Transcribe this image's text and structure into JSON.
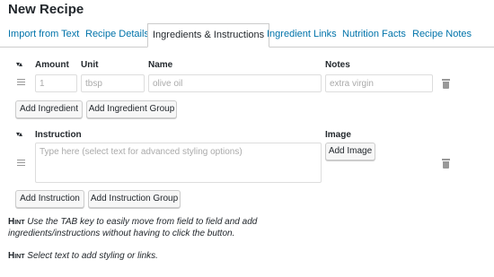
{
  "page": {
    "title": "New Recipe"
  },
  "tabs": [
    {
      "label": "Import from Text"
    },
    {
      "label": "Recipe Details"
    },
    {
      "label": "Ingredients & Instructions"
    },
    {
      "label": "Ingredient Links"
    },
    {
      "label": "Nutrition Facts"
    },
    {
      "label": "Recipe Notes"
    }
  ],
  "ingredients": {
    "headers": {
      "amount": "Amount",
      "unit": "Unit",
      "name": "Name",
      "notes": "Notes"
    },
    "sort_glyph": "▾▴",
    "row": {
      "amount_placeholder": "1",
      "unit_placeholder": "tbsp",
      "name_placeholder": "olive oil",
      "notes_placeholder": "extra virgin"
    },
    "add_ingredient_label": "Add Ingredient",
    "add_group_label": "Add Ingredient Group"
  },
  "instructions": {
    "headers": {
      "instruction": "Instruction",
      "image": "Image"
    },
    "sort_glyph": "▾▴",
    "row": {
      "instruction_placeholder": "Type here (select text for advanced styling options)",
      "add_image_label": "Add Image"
    },
    "add_instruction_label": "Add Instruction",
    "add_group_label": "Add Instruction Group"
  },
  "hints": [
    {
      "label": "Hint",
      "text": "Use the TAB key to easily move from field to field and add ingredients/instructions without having to click the button."
    },
    {
      "label": "Hint",
      "text": "Select text to add styling or links."
    }
  ]
}
